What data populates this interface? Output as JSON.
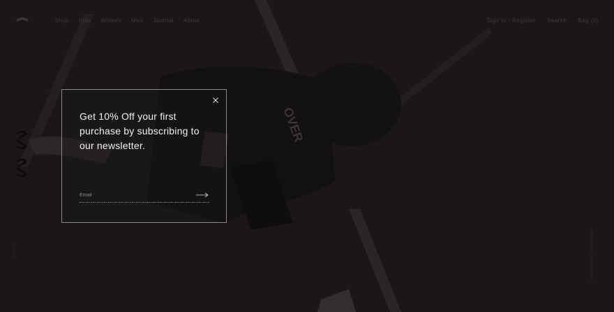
{
  "header": {
    "logo_icon": "brand-logo-icon",
    "nav_left": [
      "Shop",
      "Kids",
      "Women",
      "Men",
      "Journal",
      "About"
    ],
    "nav_right": [
      "Sign in / Register",
      "Search",
      "Bag (0)"
    ]
  },
  "left_rail": {
    "glyphs": [
      "03",
      "03"
    ],
    "vertical_text": "Scroll"
  },
  "right_rail": {
    "vertical_text": "Instagram  Facebook"
  },
  "newsletter_modal": {
    "heading": "Get 10% Off your first purchase by subscribing to our newsletter.",
    "email_placeholder": "Email",
    "email_value": "",
    "close_icon": "close-icon",
    "submit_icon": "arrow-right-icon"
  },
  "colors": {
    "background": "#1b1718",
    "modal_border": "#8e8a8b",
    "heading_text": "#f2f0f0"
  }
}
